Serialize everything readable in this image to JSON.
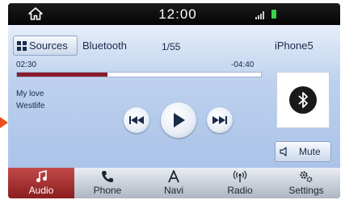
{
  "status_bar": {
    "time": "12:00",
    "icons": [
      "home-icon",
      "signal-icon",
      "battery-icon"
    ]
  },
  "player": {
    "sources_label": "Sources",
    "source_name": "Bluetooth",
    "track_count": "1/55",
    "device_name": "iPhone5",
    "time_elapsed": "02:30",
    "time_remaining": "-04:40",
    "progress_fraction": 0.37,
    "song": "My love",
    "artist": "Westlife",
    "mute_label": "Mute"
  },
  "nav": {
    "items": [
      {
        "label": "Audio",
        "icon": "music-note-icon",
        "active": true
      },
      {
        "label": "Phone",
        "icon": "phone-icon",
        "active": false
      },
      {
        "label": "Navi",
        "icon": "navigation-icon",
        "active": false
      },
      {
        "label": "Radio",
        "icon": "radio-icon",
        "active": false
      },
      {
        "label": "Settings",
        "icon": "settings-icon",
        "active": false
      }
    ]
  },
  "colors": {
    "accent": "#8a1c2c",
    "panel_bg": "#bdd1ee",
    "pointer": "#e8501d"
  }
}
